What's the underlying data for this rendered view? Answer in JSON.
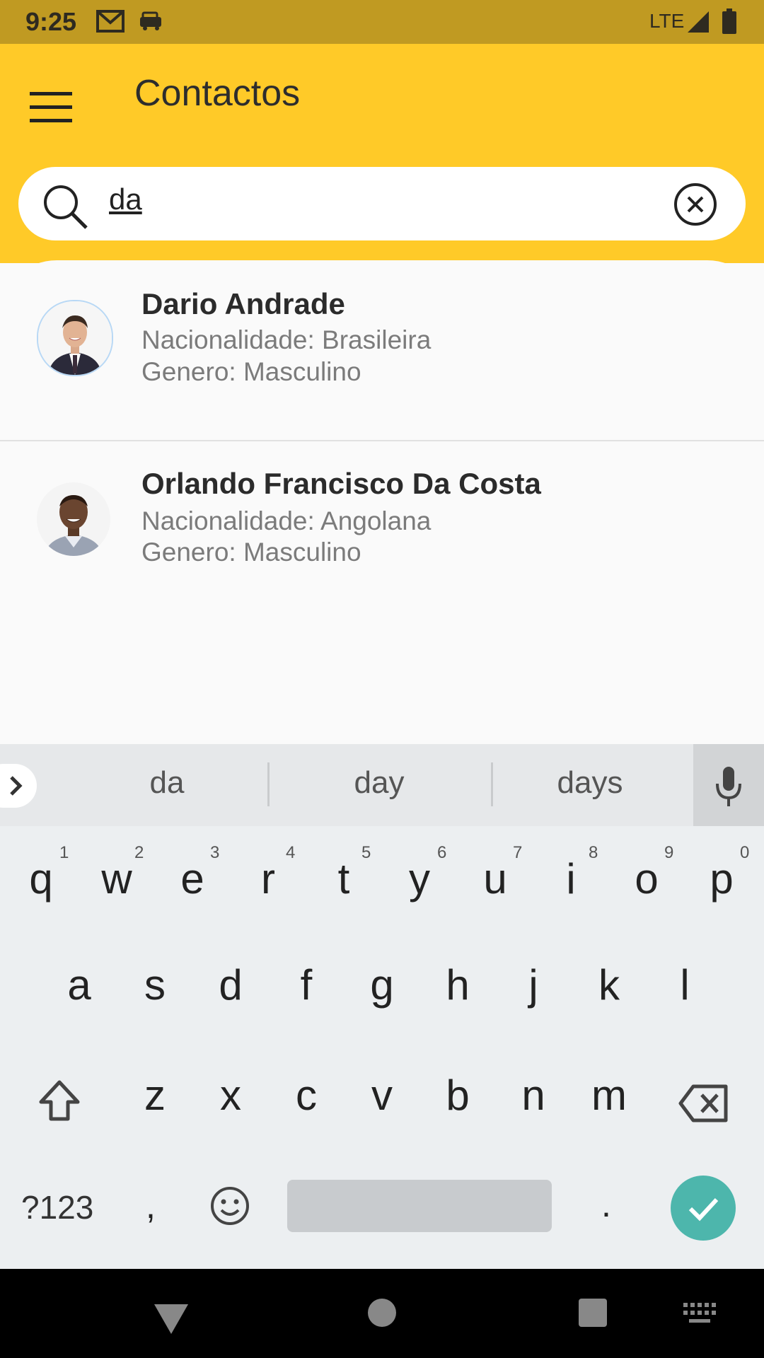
{
  "status_bar": {
    "time": "9:25",
    "network": "LTE"
  },
  "app_bar": {
    "title": "Contactos"
  },
  "search": {
    "value": "da"
  },
  "contacts": [
    {
      "name": "Dario Andrade",
      "nationality": "Nacionalidade: Brasileira",
      "gender": "Genero: Masculino"
    },
    {
      "name": "Orlando Francisco Da Costa",
      "nationality": "Nacionalidade: Angolana",
      "gender": "Genero: Masculino"
    }
  ],
  "suggestions": [
    "da",
    "day",
    "days"
  ],
  "keyboard": {
    "row1": [
      "q",
      "w",
      "e",
      "r",
      "t",
      "y",
      "u",
      "i",
      "o",
      "p"
    ],
    "row1_nums": [
      "1",
      "2",
      "3",
      "4",
      "5",
      "6",
      "7",
      "8",
      "9",
      "0"
    ],
    "row2": [
      "a",
      "s",
      "d",
      "f",
      "g",
      "h",
      "j",
      "k",
      "l"
    ],
    "row3": [
      "z",
      "x",
      "c",
      "v",
      "b",
      "n",
      "m"
    ],
    "symbols_label": "?123",
    "comma": ",",
    "period": "."
  },
  "colors": {
    "app_bar": "#ffca28",
    "status_bar": "#c09a22",
    "enter": "#4db6ac"
  }
}
